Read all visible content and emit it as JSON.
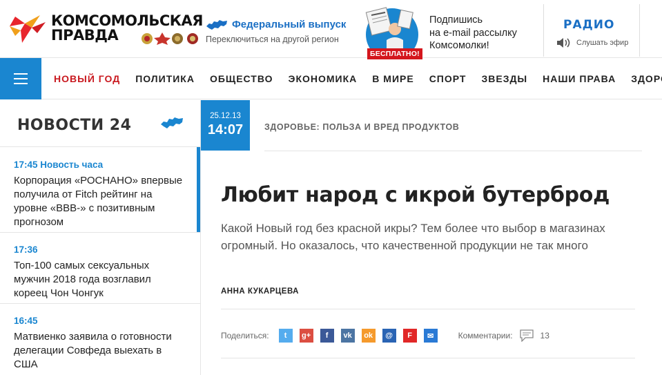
{
  "header": {
    "logo_line1": "Комсомольская",
    "logo_line2": "правда",
    "region_title": "Федеральный выпуск",
    "region_switch": "Переключиться на другой регион",
    "promo_badge": "БЕСПЛАТНО!",
    "subscribe_lines": [
      "Подпишись",
      "на e-mail рассылку",
      "Комсомолки!"
    ],
    "radio_title": "РАДИО",
    "radio_listen": "Слушать эфир"
  },
  "nav": {
    "items": [
      {
        "label": "НОВЫЙ ГОД",
        "active": true
      },
      {
        "label": "ПОЛИТИКА"
      },
      {
        "label": "ОБЩЕСТВО"
      },
      {
        "label": "ЭКОНОМИКА"
      },
      {
        "label": "В МИРЕ"
      },
      {
        "label": "СПОРТ"
      },
      {
        "label": "ЗВЕЗДЫ"
      },
      {
        "label": "НАШИ ПРАВА"
      },
      {
        "label": "ЗДОРОВЬЕ"
      }
    ]
  },
  "sidebar": {
    "title": "НОВОСТИ 24",
    "news": [
      {
        "time": "17:45 Новость часа",
        "text": "Корпорация «РОСНАНО» впервые получила от Fitch рейтинг на уровне «BBB-» с позитивным прогнозом"
      },
      {
        "time": "17:36",
        "text": "Топ-100 самых сексуальных мужчин 2018 года возглавил кореец Чон Чонгук"
      },
      {
        "time": "16:45",
        "text": "Матвиенко заявила о готовности делегации Совфеда выехать в США"
      }
    ]
  },
  "article": {
    "date": "25.12.13",
    "time": "14:07",
    "rubric": "ЗДОРОВЬЕ: ПОЛЬЗА И ВРЕД ПРОДУКТОВ",
    "title": "Любит народ с икрой бутерброд",
    "lead": "Какой Новый год без красной икры? Тем более что выбор в магазинах огромный. Но оказалось, что качественной продукции не так много",
    "author": "АННА КУКАРЦЕВА",
    "share_label": "Поделиться:",
    "comments_label": "Комментарии:",
    "comments_count": "13"
  },
  "colors": {
    "accent_blue": "#1a86d0",
    "link_blue": "#1a6fc4",
    "active_red": "#c9191f",
    "badge_red": "#d4161d"
  },
  "share_buttons": [
    {
      "icon": "twitter-icon",
      "color": "#55acee",
      "glyph": "t"
    },
    {
      "icon": "google-plus-icon",
      "color": "#dc4e41",
      "glyph": "g+"
    },
    {
      "icon": "facebook-icon",
      "color": "#3b5998",
      "glyph": "f"
    },
    {
      "icon": "vk-icon",
      "color": "#4c75a3",
      "glyph": "vk"
    },
    {
      "icon": "odnoklassniki-icon",
      "color": "#f59a2c",
      "glyph": "ok"
    },
    {
      "icon": "moimir-icon",
      "color": "#2a64b4",
      "glyph": "@"
    },
    {
      "icon": "flipboard-icon",
      "color": "#e12828",
      "glyph": "F"
    },
    {
      "icon": "email-icon",
      "color": "#2a7ad5",
      "glyph": "✉"
    }
  ]
}
